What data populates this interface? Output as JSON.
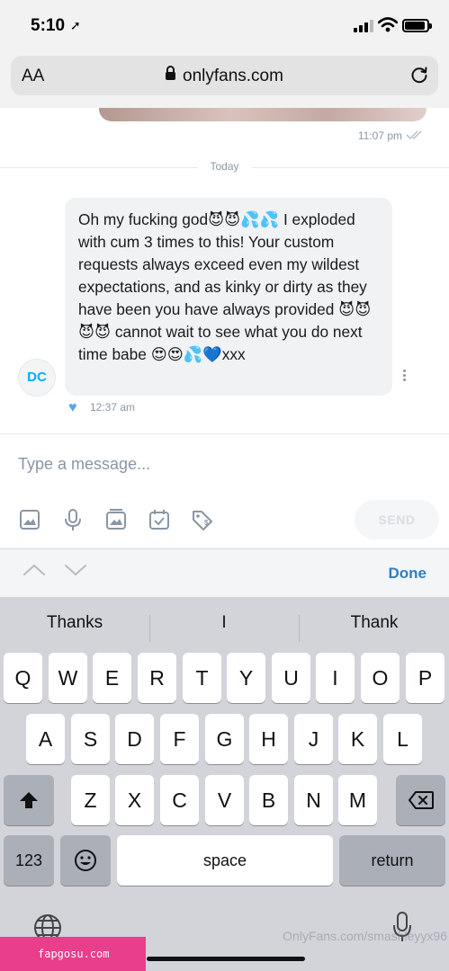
{
  "status_bar": {
    "time": "5:10",
    "location_arrow": "➚",
    "battery_level": 0.9
  },
  "browser": {
    "text_size_label": "AA",
    "url": "onlyfans.com"
  },
  "chat": {
    "previous_message_time": "11:07 pm",
    "day_divider": "Today",
    "message": {
      "avatar_initials": "DC",
      "text": "Oh my fucking god😈😈💦💦 I exploded with cum 3 times to this! Your custom requests always exceed even my wildest expectations, and as kinky or dirty as they have been you have always provided 😈😈😈😈 cannot wait to see what you do next time babe 😍😍💦💙xxx",
      "time": "12:37 am",
      "liked": true
    }
  },
  "composer": {
    "placeholder": "Type a message...",
    "send_label": "SEND",
    "tools": [
      "image-icon",
      "microphone-icon",
      "media-vault-icon",
      "calendar-icon",
      "price-tag-icon"
    ]
  },
  "accessory_bar": {
    "done_label": "Done"
  },
  "keyboard": {
    "suggestions": [
      "Thanks",
      "I",
      "Thank"
    ],
    "row1": [
      "Q",
      "W",
      "E",
      "R",
      "T",
      "Y",
      "U",
      "I",
      "O",
      "P"
    ],
    "row2": [
      "A",
      "S",
      "D",
      "F",
      "G",
      "H",
      "J",
      "K",
      "L"
    ],
    "row3": [
      "Z",
      "X",
      "C",
      "V",
      "B",
      "N",
      "M"
    ],
    "numbers_label": "123",
    "space_label": "space",
    "return_label": "return"
  },
  "watermarks": {
    "badge": "fapgosu.com",
    "text": "OnlyFans.com/smashleyyx96"
  }
}
